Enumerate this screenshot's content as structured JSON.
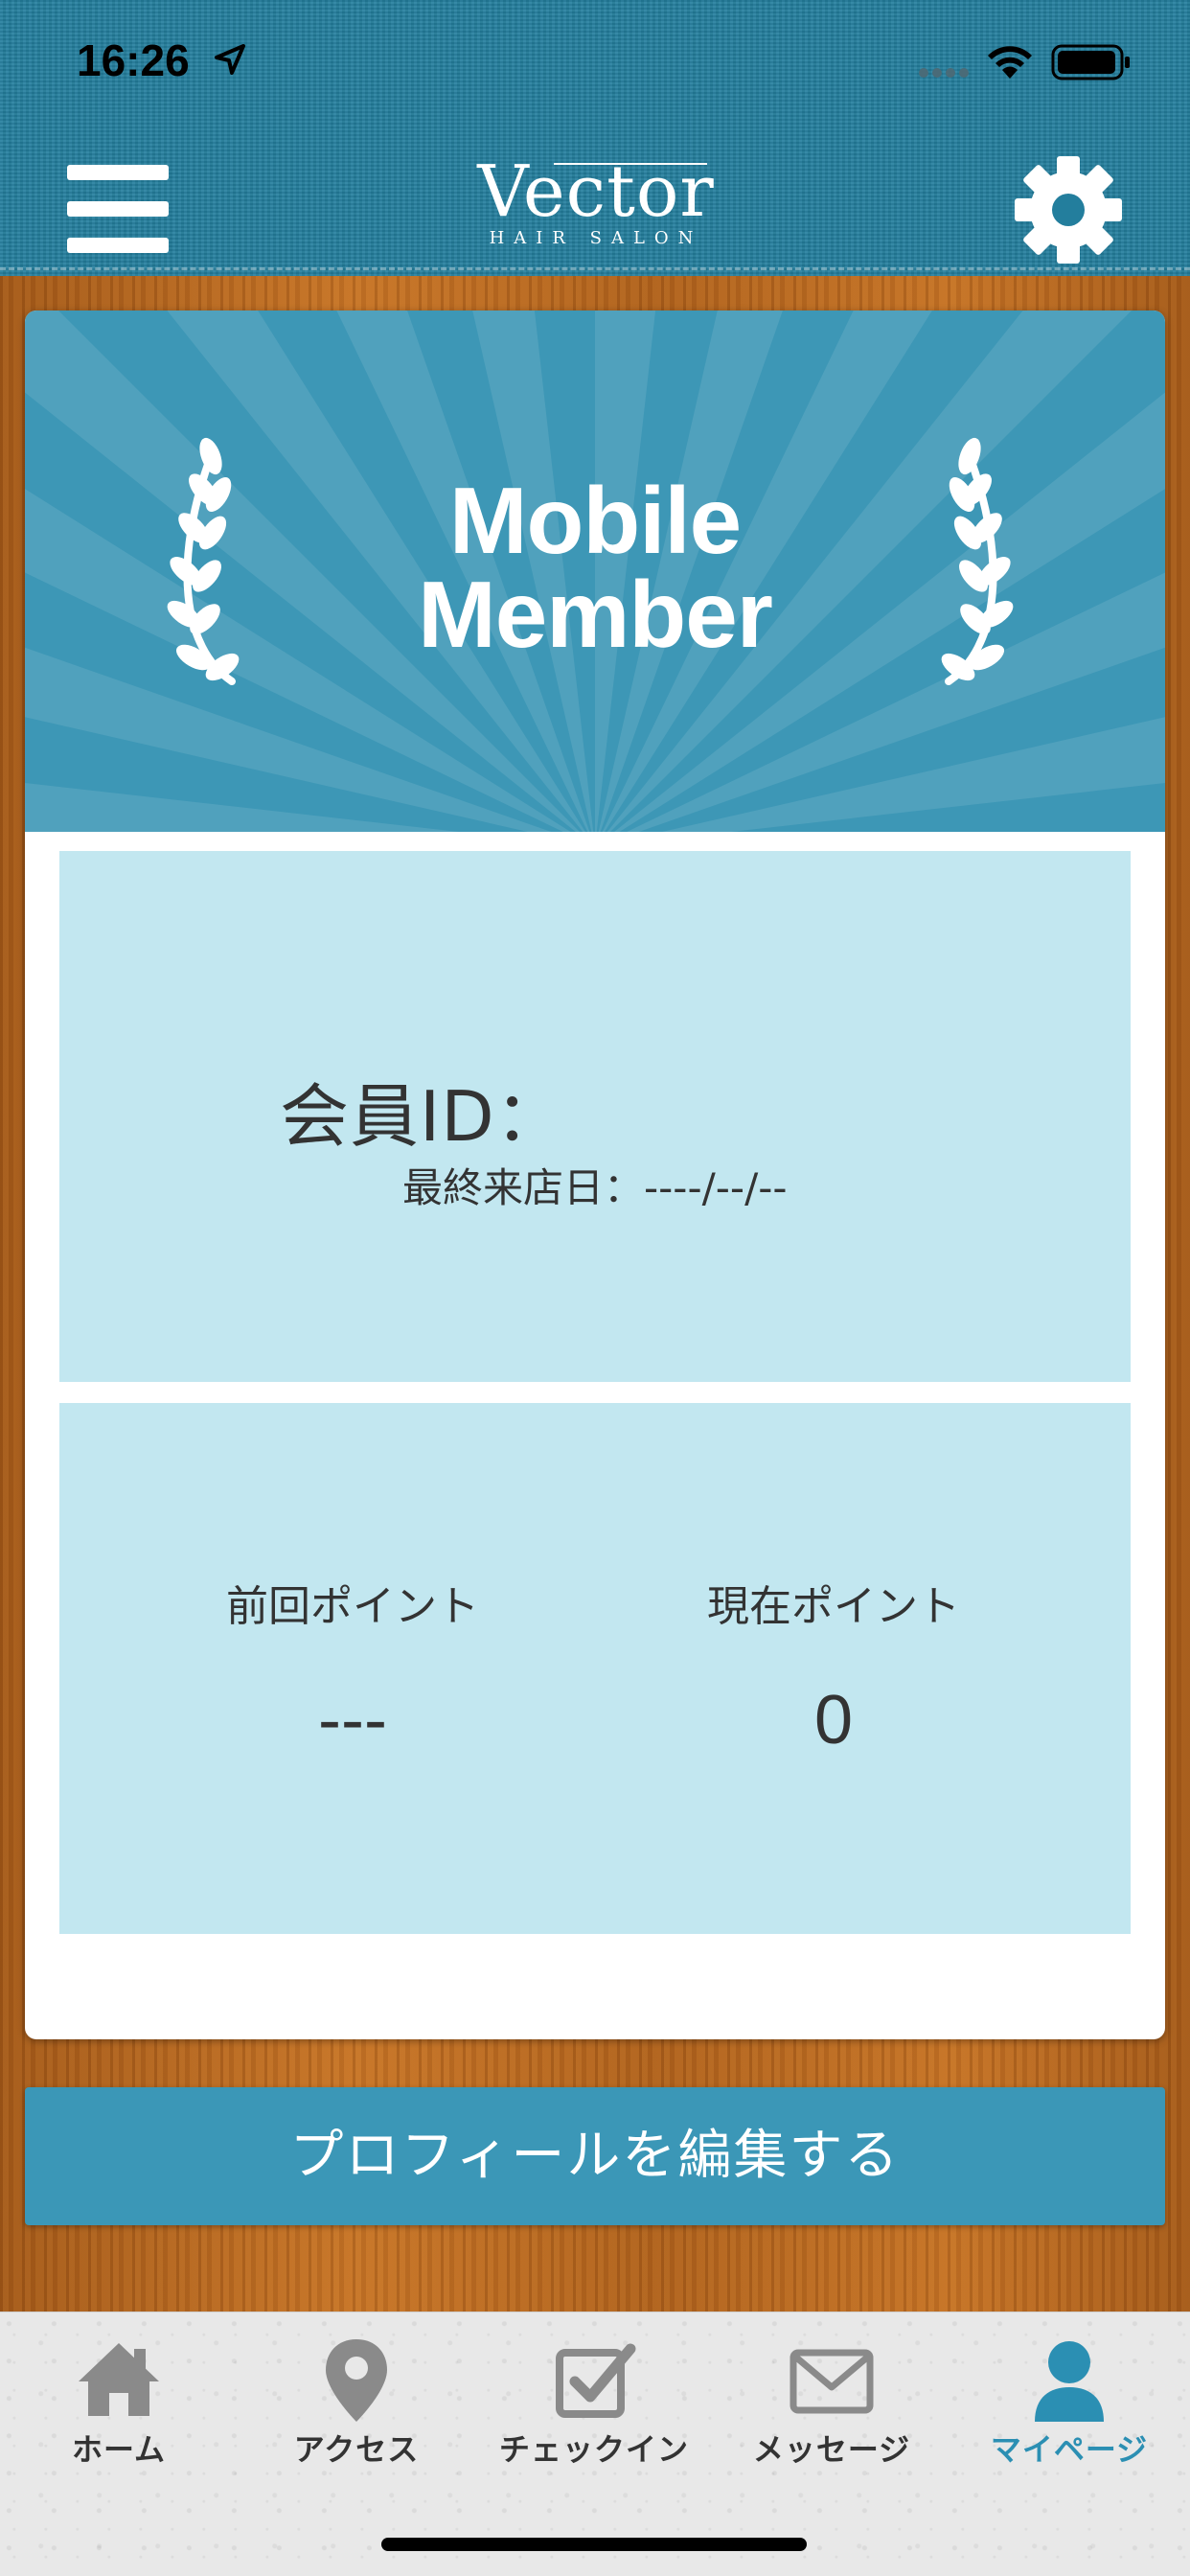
{
  "status_bar": {
    "time": "16:26"
  },
  "header": {
    "logo_main": "Vector",
    "logo_sub": "HAIR SALON"
  },
  "banner": {
    "title_line1": "Mobile",
    "title_line2": "Member"
  },
  "member": {
    "id_label": "会員ID：",
    "last_visit_label": "最終来店日：----/--/--"
  },
  "points": {
    "previous_label": "前回ポイント",
    "previous_value": "---",
    "current_label": "現在ポイント",
    "current_value": "0"
  },
  "edit_profile_label": "プロフィールを編集する",
  "tabs": [
    {
      "label": "ホーム",
      "icon": "home-icon"
    },
    {
      "label": "アクセス",
      "icon": "map-pin-icon"
    },
    {
      "label": "チェックイン",
      "icon": "checkbox-icon"
    },
    {
      "label": "メッセージ",
      "icon": "envelope-icon"
    },
    {
      "label": "マイページ",
      "icon": "user-icon",
      "active": true
    }
  ],
  "colors": {
    "header_teal": "#237e9d",
    "banner_blue": "#3d97b6",
    "panel_light_blue": "#c2e7f0",
    "button_blue": "#3b97b7",
    "active_tab": "#2b8fb3"
  }
}
